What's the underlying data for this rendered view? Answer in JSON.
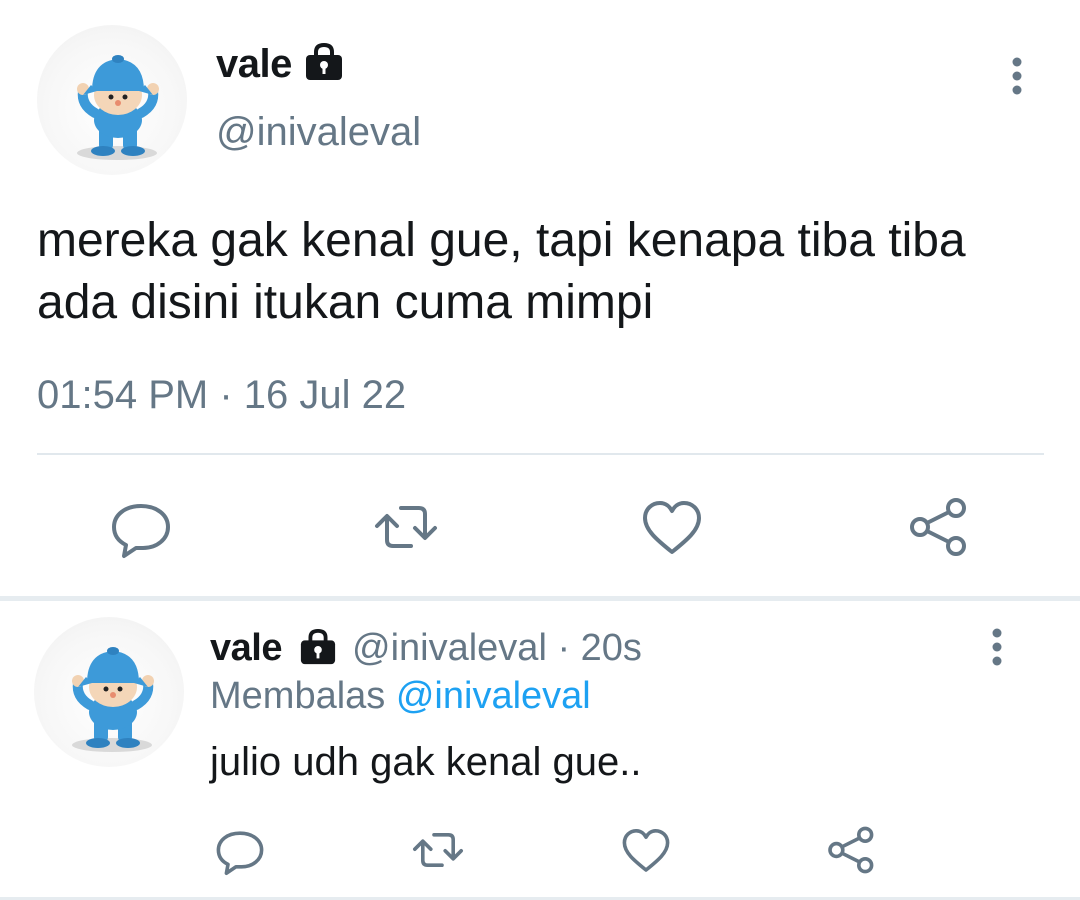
{
  "main_tweet": {
    "name": "vale",
    "handle": "@inivaleval",
    "text": "mereka gak kenal gue, tapi kenapa tiba tiba ada disini itukan cuma mimpi",
    "timestamp": "01:54 PM · 16 Jul 22",
    "avatar": "pocoyo-avatar",
    "badge_icon": "lock-icon",
    "actions": [
      "reply-icon",
      "retweet-icon",
      "like-icon",
      "share-icon"
    ]
  },
  "reply_tweet": {
    "name": "vale",
    "handle_time": "@inivaleval · 20s",
    "replying_label": "Membalas",
    "replying_to": "@inivaleval",
    "text": "julio udh gak kenal gue..",
    "avatar": "pocoyo-avatar",
    "badge_icon": "lock-icon",
    "actions": [
      "reply-icon",
      "retweet-icon",
      "like-icon",
      "share-icon"
    ]
  },
  "colors": {
    "text": "#14171a",
    "secondary": "#657786",
    "link": "#1da1f2",
    "divider": "#e1e8ed",
    "icon": "#657786"
  }
}
